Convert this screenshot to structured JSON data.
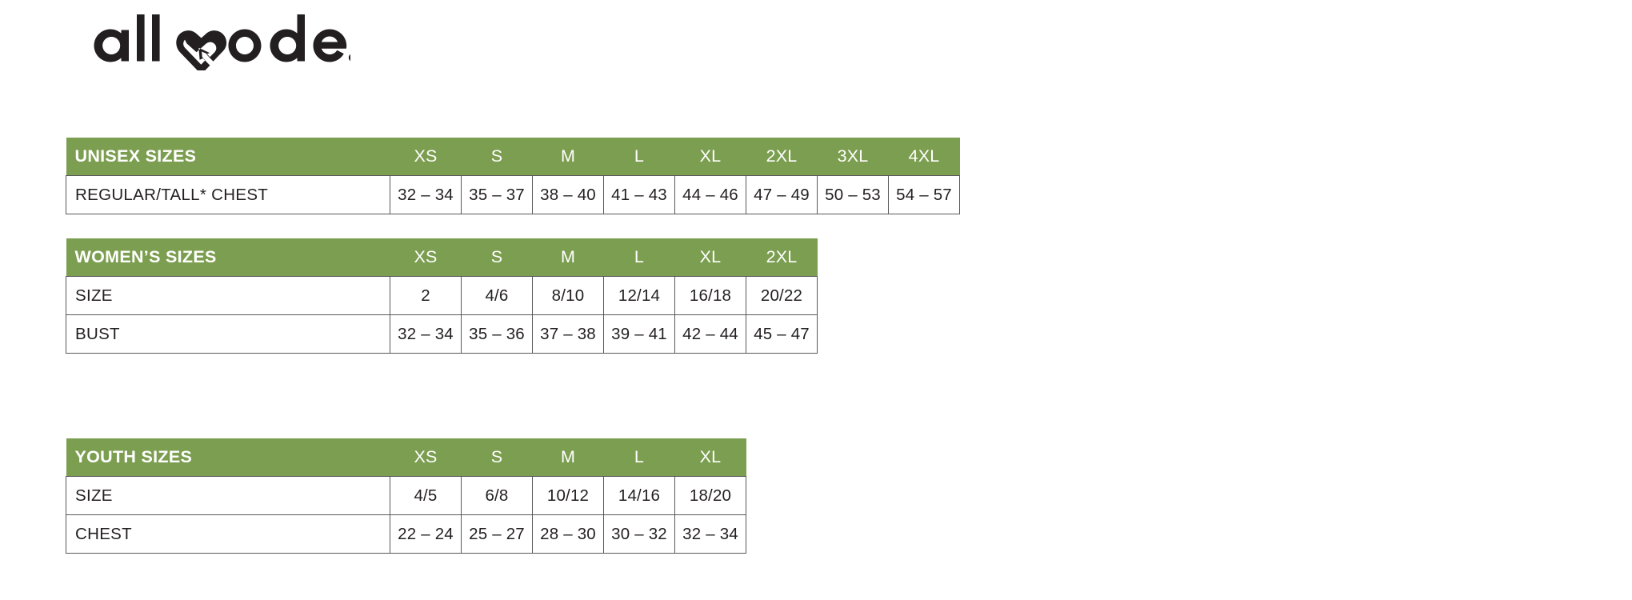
{
  "brand": {
    "name": "allmade.",
    "logo_icon": "allmade-heart-arrow-logo",
    "color": "#231f20"
  },
  "theme": {
    "header_green": "#7c9e50",
    "border_gray": "#59595b",
    "text_dark": "#231f20",
    "header_text": "#ffffff"
  },
  "tables": [
    {
      "id": "unisex",
      "title": "UNISEX SIZES",
      "sizes": [
        "XS",
        "S",
        "M",
        "L",
        "XL",
        "2XL",
        "3XL",
        "4XL"
      ],
      "rows": [
        {
          "label": "REGULAR/TALL* CHEST",
          "values": [
            "32 – 34",
            "35 – 37",
            "38 – 40",
            "41 – 43",
            "44 – 46",
            "47 – 49",
            "50 – 53",
            "54 – 57"
          ]
        }
      ]
    },
    {
      "id": "womens",
      "title": "WOMEN’S SIZES",
      "sizes": [
        "XS",
        "S",
        "M",
        "L",
        "XL",
        "2XL"
      ],
      "rows": [
        {
          "label": "SIZE",
          "values": [
            "2",
            "4/6",
            "8/10",
            "12/14",
            "16/18",
            "20/22"
          ]
        },
        {
          "label": "BUST",
          "values": [
            "32 – 34",
            "35 – 36",
            "37 – 38",
            "39 – 41",
            "42 – 44",
            "45 – 47"
          ]
        }
      ]
    },
    {
      "id": "youth",
      "title": "YOUTH SIZES",
      "sizes": [
        "XS",
        "S",
        "M",
        "L",
        "XL"
      ],
      "rows": [
        {
          "label": "SIZE",
          "values": [
            "4/5",
            "6/8",
            "10/12",
            "14/16",
            "18/20"
          ]
        },
        {
          "label": "CHEST",
          "values": [
            "22 – 24",
            "25 – 27",
            "28 – 30",
            "30 – 32",
            "32 – 34"
          ]
        }
      ]
    }
  ]
}
